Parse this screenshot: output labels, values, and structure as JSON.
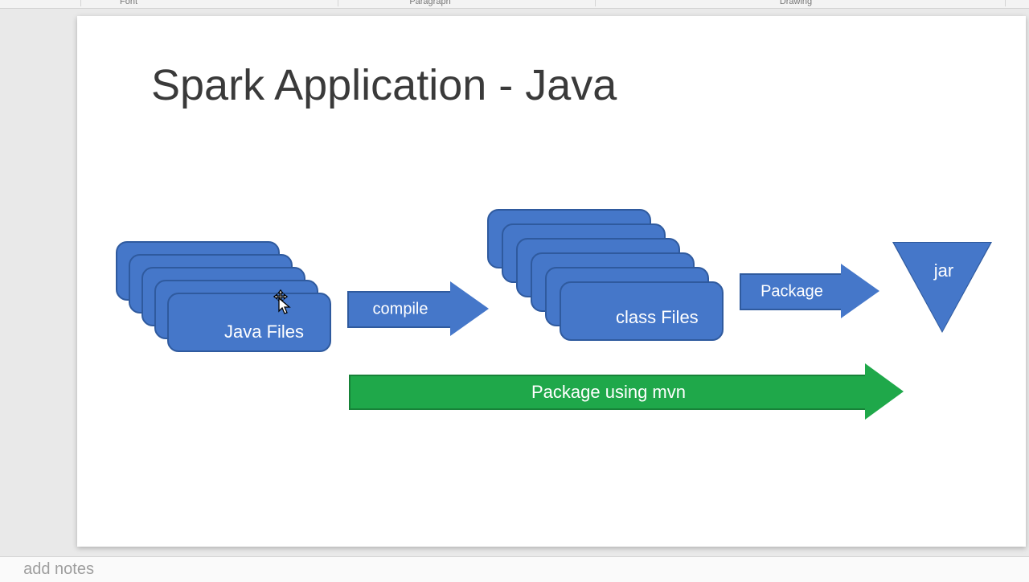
{
  "ribbon": {
    "group_font": "Font",
    "group_paragraph": "Paragraph",
    "group_drawing": "Drawing"
  },
  "slide": {
    "title": "Spark Application - Java",
    "java_stack_label": "Java Files",
    "class_stack_label": "class Files",
    "arrow_compile": "compile",
    "arrow_package": "Package",
    "triangle_jar": "jar",
    "arrow_mvn": "Package using mvn"
  },
  "notes_placeholder": "add notes",
  "chart_data": {
    "type": "flow",
    "title": "Spark Application - Java",
    "nodes": [
      {
        "id": "java_files",
        "label": "Java Files",
        "shape": "stacked-rects"
      },
      {
        "id": "class_files",
        "label": "class Files",
        "shape": "stacked-rects"
      },
      {
        "id": "jar",
        "label": "jar",
        "shape": "triangle-down"
      }
    ],
    "edges": [
      {
        "from": "java_files",
        "to": "class_files",
        "label": "compile",
        "color": "#4577c9"
      },
      {
        "from": "class_files",
        "to": "jar",
        "label": "Package",
        "color": "#4577c9"
      },
      {
        "from": "java_files",
        "to": "jar",
        "label": "Package using mvn",
        "color": "#1fa84a"
      }
    ]
  }
}
